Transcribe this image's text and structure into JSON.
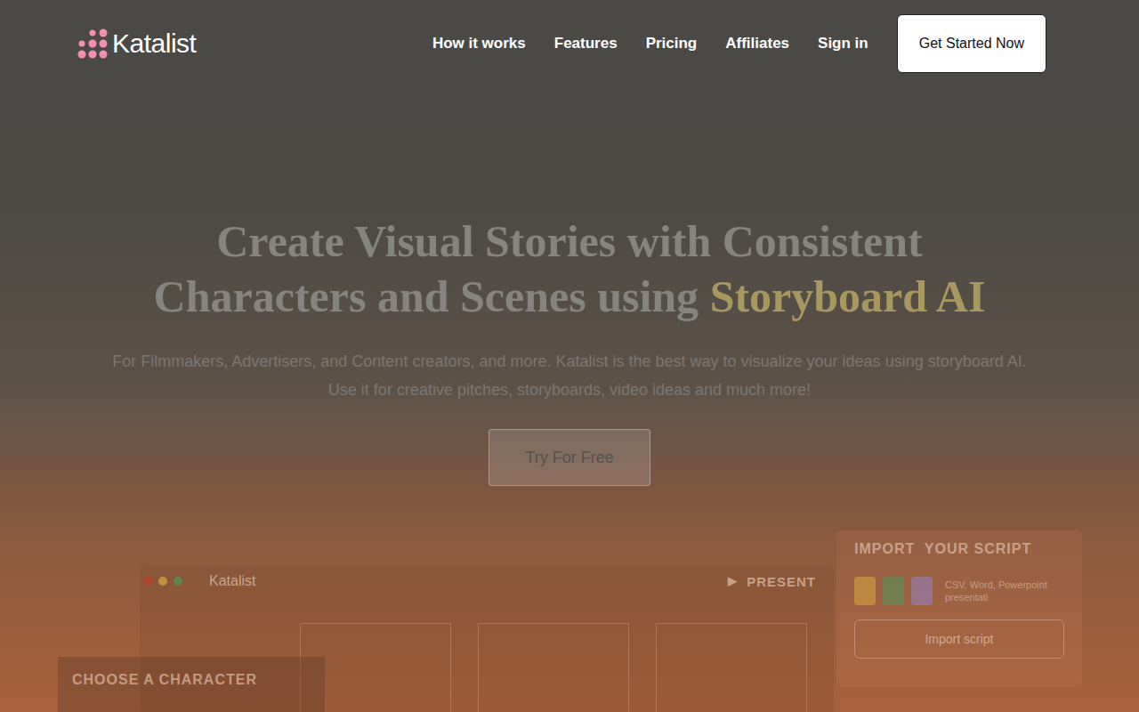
{
  "nav": {
    "logo": "Katalist",
    "links": [
      "How it works",
      "Features",
      "Pricing",
      "Affiliates",
      "Sign in"
    ],
    "cta": "Get Started Now"
  },
  "hero": {
    "title_line1": "Create Visual Stories with Consistent",
    "title_line2": "Characters and Scenes using ",
    "title_highlight": "Storyboard AI",
    "subtitle": [
      "For Filmmakers, Advertisers, and Content creators, and more. Katalist is the best way to visualize your ideas using storyboard AI.",
      "Use it for creative pitches, storyboards, video ideas and much more!"
    ],
    "button": "Try For Free"
  },
  "mockup": {
    "app_name": "Katalist",
    "present_icon": "▶",
    "present": "PRESENT",
    "window_dots": [
      {
        "color": "#c0392b"
      },
      {
        "color": "#d9a83a"
      },
      {
        "color": "#4f9a5a"
      }
    ],
    "character_panel": {
      "title": "CHOOSE A CHARACTER"
    },
    "import_panel": {
      "title": "IMPORT  YOUR SCRIPT",
      "format_icons": [
        {
          "color": "#e5b53a"
        },
        {
          "color": "#3f9e5a"
        },
        {
          "color": "#8e8be0"
        }
      ],
      "formats": "CSV, Word, Powerpoint presentati",
      "button": "Import script"
    }
  }
}
